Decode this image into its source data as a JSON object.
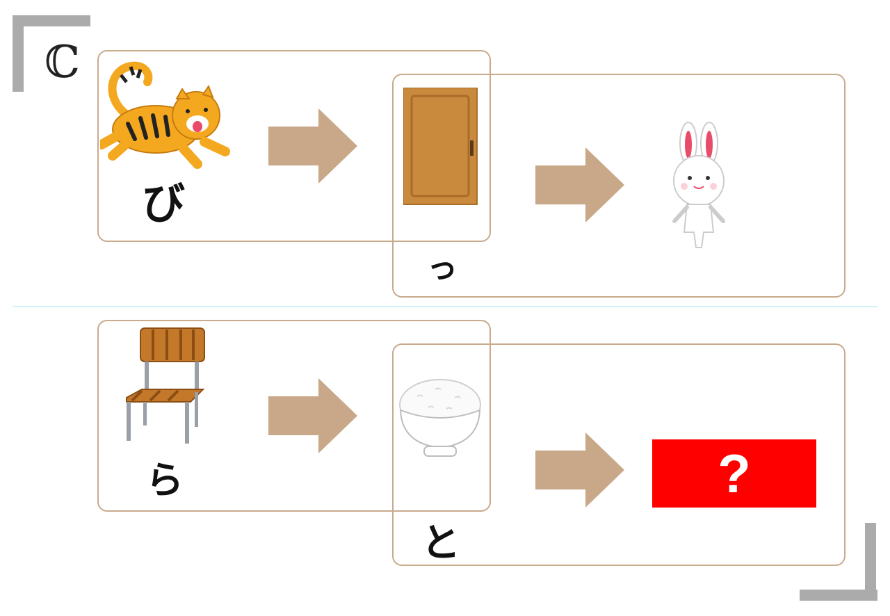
{
  "label_letter": "ℂ",
  "rows": [
    {
      "first_kana": "び",
      "second_kana": "っ",
      "result": "rabbit"
    },
    {
      "first_kana": "ら",
      "second_kana": "と",
      "result": "?"
    }
  ],
  "icons": [
    "tiger-icon",
    "door-icon",
    "rabbit-icon",
    "chair-icon",
    "rice-bowl-icon"
  ],
  "colors": {
    "frame": "#c8aa8c",
    "arrow": "#c8a888",
    "question_bg": "#ff0000",
    "corner": "#ababab",
    "divider": "#cdf3f6"
  }
}
